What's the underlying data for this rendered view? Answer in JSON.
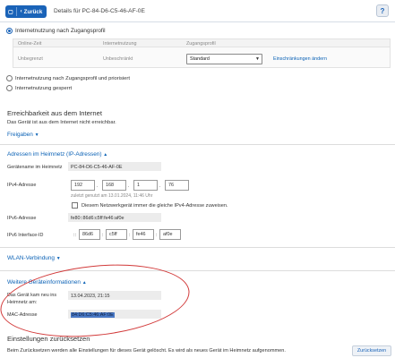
{
  "header": {
    "back_label": "Zurück",
    "title": "Details für PC-84-D6-C5-46-AF-0E",
    "help_label": "?"
  },
  "access": {
    "profile_option": "Internetnutzung nach Zugangsprofil",
    "table": {
      "headers": [
        "Online-Zeit",
        "Internetnutzung",
        "Zugangsprofil"
      ],
      "row": {
        "online_time": "Unbegrenzt",
        "usage": "Unbeschränkt",
        "profile_value": "Standard",
        "link": "Einschränkungen ändern"
      }
    },
    "prioritized_option": "Internetnutzung nach Zugangsprofil und priorisiert",
    "blocked_option": "Internetnutzung gesperrt"
  },
  "reachability": {
    "title": "Erreichbarkeit aus dem Internet",
    "status": "Das Gerät ist aus dem Internet nicht erreichbar.",
    "shares_link": "Freigaben"
  },
  "home_network": {
    "title": "Adressen im Heimnetz (IP-Adressen)",
    "name_label": "Gerätename im Heimnetz",
    "name_value": "PC-84-D6-C5-46-AF-0E",
    "ipv4_label": "IPv4-Adresse",
    "ipv4_octets": [
      "192",
      "168",
      "1",
      "76"
    ],
    "ipv4_note": "zuletzt genutzt am 13.01.2024, 11:46 Uhr",
    "fixed_ipv4_label": "Diesem Netzwerkgerät immer die gleiche IPv4-Adresse zuweisen.",
    "ipv6_label": "IPv6-Adresse",
    "ipv6_value": "fe80::86d6:c5ff:fe46:af0e",
    "ipv6_iface_label": "IPv6 Interface-ID",
    "ipv6_iface_parts": [
      "86d6",
      "c5ff",
      "fe46",
      "af0e"
    ],
    "iface_prefix": "::",
    "iface_sep": ":"
  },
  "wlan": {
    "link": "WLAN-Verbindung"
  },
  "device_info": {
    "title": "Weitere Geräteinformationen",
    "first_seen_label_1": "Das Gerät kam neu ins",
    "first_seen_label_2": "Heimnetz am:",
    "first_seen_value": "13.04.2023, 21:15",
    "mac_label": "MAC-Adresse",
    "mac_value": "84:D6:C5:46:AF:0E"
  },
  "reset": {
    "title": "Einstellungen zurücksetzen",
    "text": "Beim Zurücksetzen werden alle Einstellungen für dieses Gerät gelöscht. Es wird als neues Gerät im Heimnetz aufgenommen.",
    "button": "Zurücksetzen"
  },
  "colors": {
    "accent": "#1a63b8",
    "link": "#0b62b6",
    "annotation": "#d23a3a",
    "selection": "#4a79c6"
  }
}
